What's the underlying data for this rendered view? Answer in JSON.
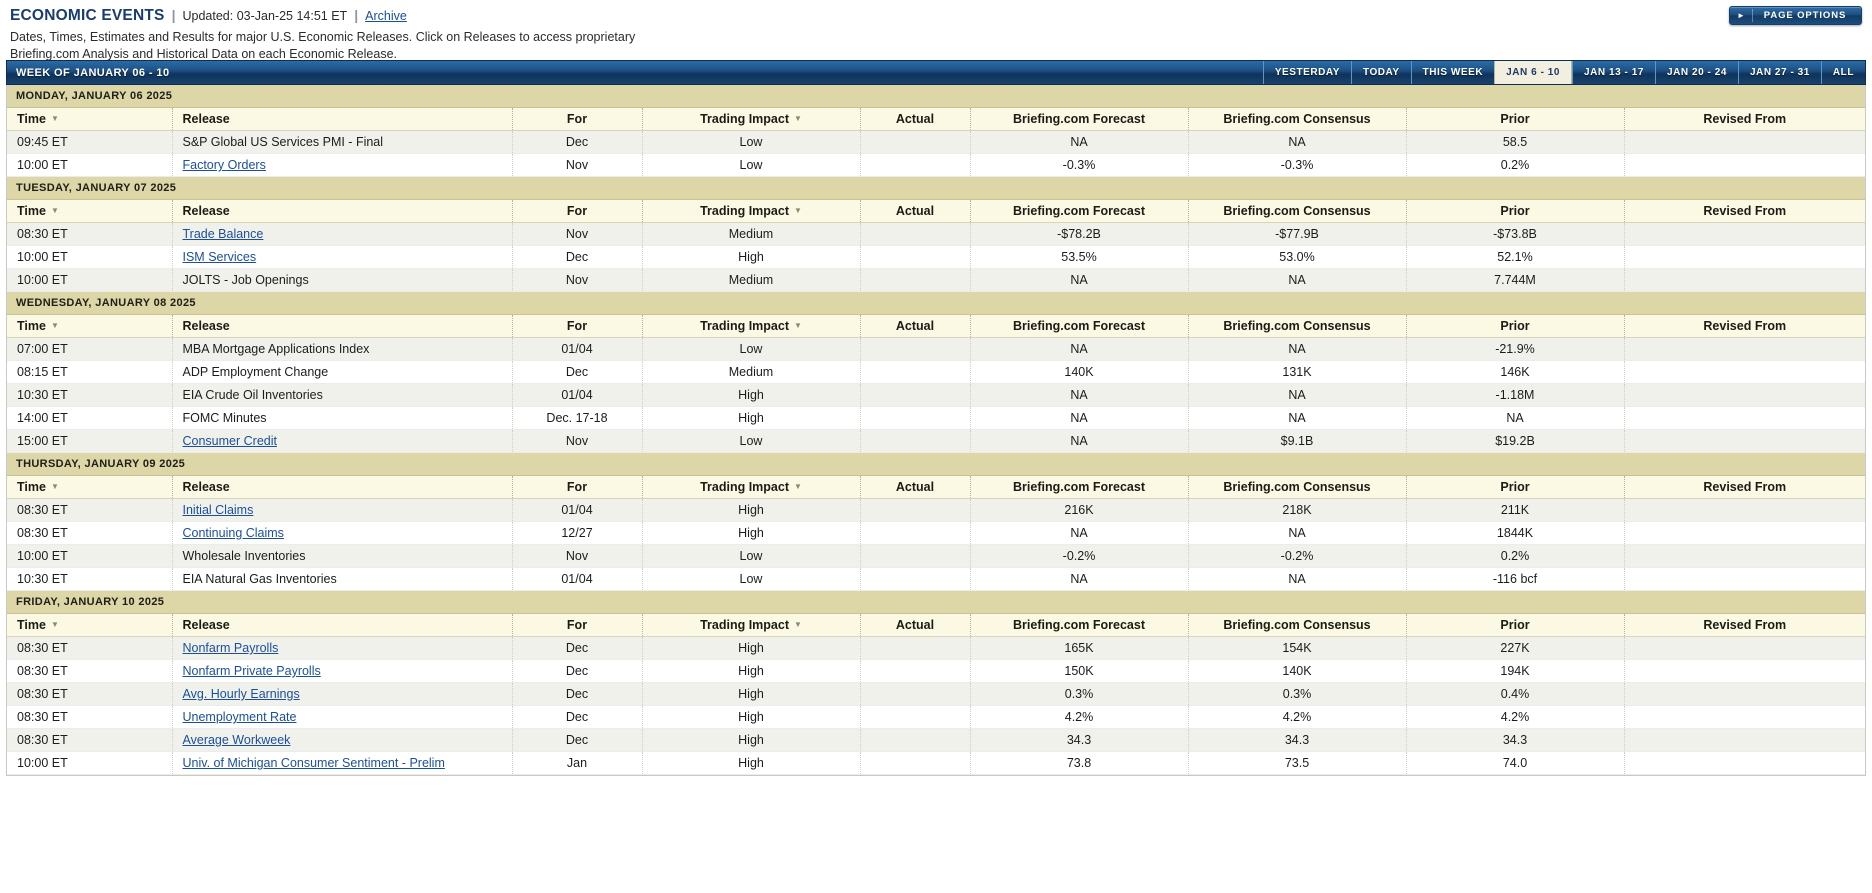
{
  "header": {
    "title": "ECONOMIC EVENTS",
    "separator": "|",
    "updated": "Updated: 03-Jan-25 14:51 ET",
    "archive_label": "Archive",
    "description": "Dates, Times, Estimates and Results for major U.S. Economic Releases. Click on Releases to access proprietary Briefing.com Analysis and Historical Data on each Economic Release.",
    "page_options_label": "PAGE OPTIONS",
    "page_options_arrow": "►"
  },
  "weekbar": {
    "title": "WEEK OF JANUARY 06 - 10",
    "tabs": [
      {
        "label": "YESTERDAY",
        "active": false
      },
      {
        "label": "TODAY",
        "active": false
      },
      {
        "label": "THIS WEEK",
        "active": false
      },
      {
        "label": "JAN 6 - 10",
        "active": true
      },
      {
        "label": "JAN 13 - 17",
        "active": false
      },
      {
        "label": "JAN 20 - 24",
        "active": false
      },
      {
        "label": "JAN 27 - 31",
        "active": false
      },
      {
        "label": "ALL",
        "active": false
      }
    ]
  },
  "columns": {
    "time": "Time",
    "release": "Release",
    "for": "For",
    "impact": "Trading Impact",
    "actual": "Actual",
    "forecast": "Briefing.com Forecast",
    "consensus": "Briefing.com Consensus",
    "prior": "Prior",
    "revised": "Revised From",
    "sort_caret": "▼"
  },
  "colors": {
    "accent_blue": "#1a3c6e",
    "link_blue": "#1a4f9c",
    "day_header_bg": "#ddd6a7",
    "col_header_bg": "#fbf8e3",
    "row_odd_bg": "#f1f1ec",
    "row_even_bg": "#ffffff",
    "active_tab_bg": "#f2efe0"
  },
  "days": [
    {
      "label": "MONDAY, JANUARY 06 2025",
      "rows": [
        {
          "time": "09:45 ET",
          "release": "S&P Global US Services PMI - Final",
          "link": false,
          "for": "Dec",
          "impact": "Low",
          "actual": "",
          "forecast": "NA",
          "consensus": "NA",
          "prior": "58.5",
          "revised": ""
        },
        {
          "time": "10:00 ET",
          "release": "Factory Orders",
          "link": true,
          "for": "Nov",
          "impact": "Low",
          "actual": "",
          "forecast": "-0.3%",
          "consensus": "-0.3%",
          "prior": "0.2%",
          "revised": ""
        }
      ]
    },
    {
      "label": "TUESDAY, JANUARY 07 2025",
      "rows": [
        {
          "time": "08:30 ET",
          "release": "Trade Balance",
          "link": true,
          "for": "Nov",
          "impact": "Medium",
          "actual": "",
          "forecast": "-$78.2B",
          "consensus": "-$77.9B",
          "prior": "-$73.8B",
          "revised": ""
        },
        {
          "time": "10:00 ET",
          "release": "ISM Services",
          "link": true,
          "for": "Dec",
          "impact": "High",
          "actual": "",
          "forecast": "53.5%",
          "consensus": "53.0%",
          "prior": "52.1%",
          "revised": ""
        },
        {
          "time": "10:00 ET",
          "release": "JOLTS - Job Openings",
          "link": false,
          "for": "Nov",
          "impact": "Medium",
          "actual": "",
          "forecast": "NA",
          "consensus": "NA",
          "prior": "7.744M",
          "revised": ""
        }
      ]
    },
    {
      "label": "WEDNESDAY, JANUARY 08 2025",
      "rows": [
        {
          "time": "07:00 ET",
          "release": "MBA Mortgage Applications Index",
          "link": false,
          "for": "01/04",
          "impact": "Low",
          "actual": "",
          "forecast": "NA",
          "consensus": "NA",
          "prior": "-21.9%",
          "revised": ""
        },
        {
          "time": "08:15 ET",
          "release": "ADP Employment Change",
          "link": false,
          "for": "Dec",
          "impact": "Medium",
          "actual": "",
          "forecast": "140K",
          "consensus": "131K",
          "prior": "146K",
          "revised": ""
        },
        {
          "time": "10:30 ET",
          "release": "EIA Crude Oil Inventories",
          "link": false,
          "for": "01/04",
          "impact": "High",
          "actual": "",
          "forecast": "NA",
          "consensus": "NA",
          "prior": "-1.18M",
          "revised": ""
        },
        {
          "time": "14:00 ET",
          "release": "FOMC Minutes",
          "link": false,
          "for": "Dec. 17-18",
          "impact": "High",
          "actual": "",
          "forecast": "NA",
          "consensus": "NA",
          "prior": "NA",
          "revised": ""
        },
        {
          "time": "15:00 ET",
          "release": "Consumer Credit",
          "link": true,
          "for": "Nov",
          "impact": "Low",
          "actual": "",
          "forecast": "NA",
          "consensus": "$9.1B",
          "prior": "$19.2B",
          "revised": ""
        }
      ]
    },
    {
      "label": "THURSDAY, JANUARY 09 2025",
      "rows": [
        {
          "time": "08:30 ET",
          "release": "Initial Claims",
          "link": true,
          "for": "01/04",
          "impact": "High",
          "actual": "",
          "forecast": "216K",
          "consensus": "218K",
          "prior": "211K",
          "revised": ""
        },
        {
          "time": "08:30 ET",
          "release": "Continuing Claims",
          "link": true,
          "for": "12/27",
          "impact": "High",
          "actual": "",
          "forecast": "NA",
          "consensus": "NA",
          "prior": "1844K",
          "revised": ""
        },
        {
          "time": "10:00 ET",
          "release": "Wholesale Inventories",
          "link": false,
          "for": "Nov",
          "impact": "Low",
          "actual": "",
          "forecast": "-0.2%",
          "consensus": "-0.2%",
          "prior": "0.2%",
          "revised": ""
        },
        {
          "time": "10:30 ET",
          "release": "EIA Natural Gas Inventories",
          "link": false,
          "for": "01/04",
          "impact": "Low",
          "actual": "",
          "forecast": "NA",
          "consensus": "NA",
          "prior": "-116 bcf",
          "revised": ""
        }
      ]
    },
    {
      "label": "FRIDAY, JANUARY 10 2025",
      "rows": [
        {
          "time": "08:30 ET",
          "release": "Nonfarm Payrolls",
          "link": true,
          "for": "Dec",
          "impact": "High",
          "actual": "",
          "forecast": "165K",
          "consensus": "154K",
          "prior": "227K",
          "revised": ""
        },
        {
          "time": "08:30 ET",
          "release": "Nonfarm Private Payrolls",
          "link": true,
          "for": "Dec",
          "impact": "High",
          "actual": "",
          "forecast": "150K",
          "consensus": "140K",
          "prior": "194K",
          "revised": ""
        },
        {
          "time": "08:30 ET",
          "release": "Avg. Hourly Earnings",
          "link": true,
          "for": "Dec",
          "impact": "High",
          "actual": "",
          "forecast": "0.3%",
          "consensus": "0.3%",
          "prior": "0.4%",
          "revised": ""
        },
        {
          "time": "08:30 ET",
          "release": "Unemployment Rate",
          "link": true,
          "for": "Dec",
          "impact": "High",
          "actual": "",
          "forecast": "4.2%",
          "consensus": "4.2%",
          "prior": "4.2%",
          "revised": ""
        },
        {
          "time": "08:30 ET",
          "release": "Average Workweek",
          "link": true,
          "for": "Dec",
          "impact": "High",
          "actual": "",
          "forecast": "34.3",
          "consensus": "34.3",
          "prior": "34.3",
          "revised": ""
        },
        {
          "time": "10:00 ET",
          "release": "Univ. of Michigan Consumer Sentiment - Prelim",
          "link": true,
          "for": "Jan",
          "impact": "High",
          "actual": "",
          "forecast": "73.8",
          "consensus": "73.5",
          "prior": "74.0",
          "revised": ""
        }
      ]
    }
  ]
}
